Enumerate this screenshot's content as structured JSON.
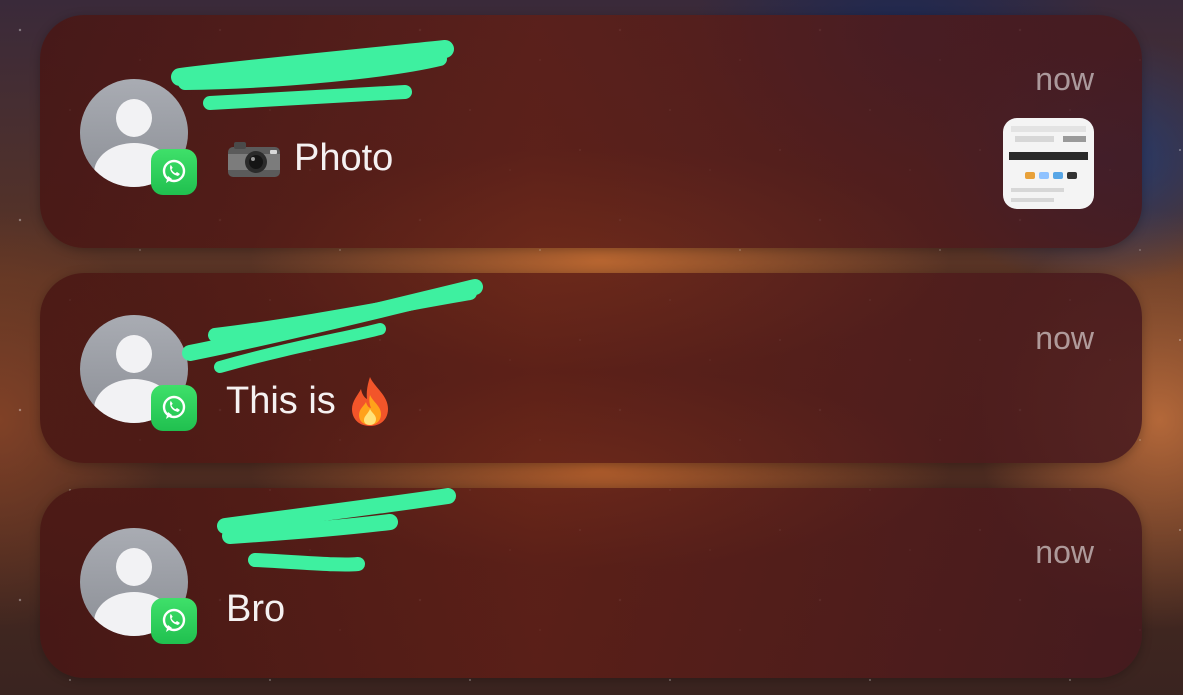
{
  "notifications": [
    {
      "app": "WhatsApp",
      "sender": "",
      "time": "now",
      "message": "Photo",
      "message_icon": "camera-emoji",
      "has_thumbnail": true
    },
    {
      "app": "WhatsApp",
      "sender": "",
      "time": "now",
      "message": "This is",
      "message_icon": "fire-emoji"
    },
    {
      "app": "WhatsApp",
      "sender": "",
      "time": "now",
      "message": "Bro"
    }
  ],
  "colors": {
    "whatsapp_green": "#25D366",
    "redaction_scribble": "#3EF0A0",
    "card_background": "#5A1E18"
  }
}
